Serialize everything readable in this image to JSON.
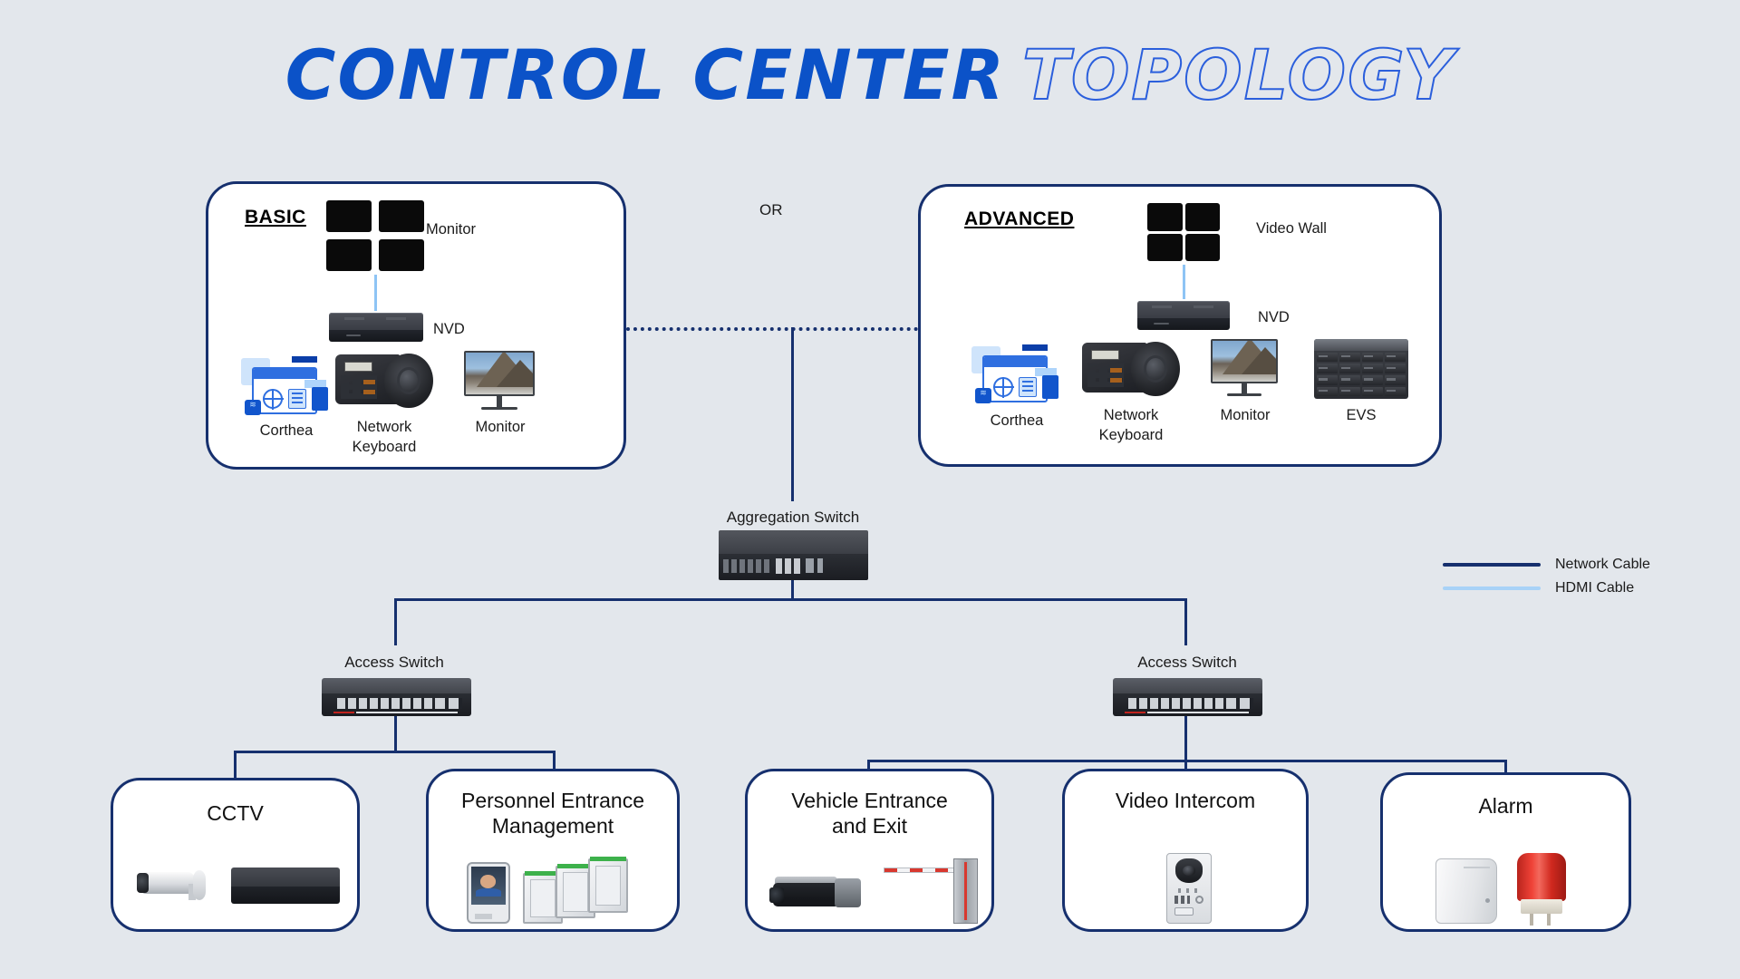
{
  "title": {
    "solid": "CONTROL CENTER",
    "outline": "TOPOLOGY"
  },
  "or_label": "OR",
  "panels": {
    "basic": {
      "heading": "BASIC",
      "labels": {
        "monitor_top": "Monitor",
        "nvd": "NVD",
        "corthea": "Corthea",
        "network_keyboard": "Network\nKeyboard",
        "monitor": "Monitor"
      }
    },
    "advanced": {
      "heading": "ADVANCED",
      "labels": {
        "video_wall": "Video Wall",
        "nvd": "NVD",
        "corthea": "Corthea",
        "network_keyboard": "Network\nKeyboard",
        "monitor": "Monitor",
        "evs": "EVS"
      }
    }
  },
  "network": {
    "aggregation_switch": "Aggregation Switch",
    "access_switch_left": "Access Switch",
    "access_switch_right": "Access Switch"
  },
  "categories": [
    {
      "label": "CCTV"
    },
    {
      "label": "Personnel Entrance\nManagement"
    },
    {
      "label": "Vehicle Entrance\nand Exit"
    },
    {
      "label": "Video Intercom"
    },
    {
      "label": "Alarm"
    }
  ],
  "legend": [
    {
      "label": "Network Cable",
      "color": "#16306e"
    },
    {
      "label": "HDMI Cable",
      "color": "#a8d2f7"
    }
  ],
  "colors": {
    "background": "#e3e7ec",
    "panel_border": "#16306e",
    "title_solid": "#0b52c8",
    "title_outline": "#2b5fdc",
    "network_cable": "#16306e",
    "hdmi_cable": "#8ec4f5"
  }
}
